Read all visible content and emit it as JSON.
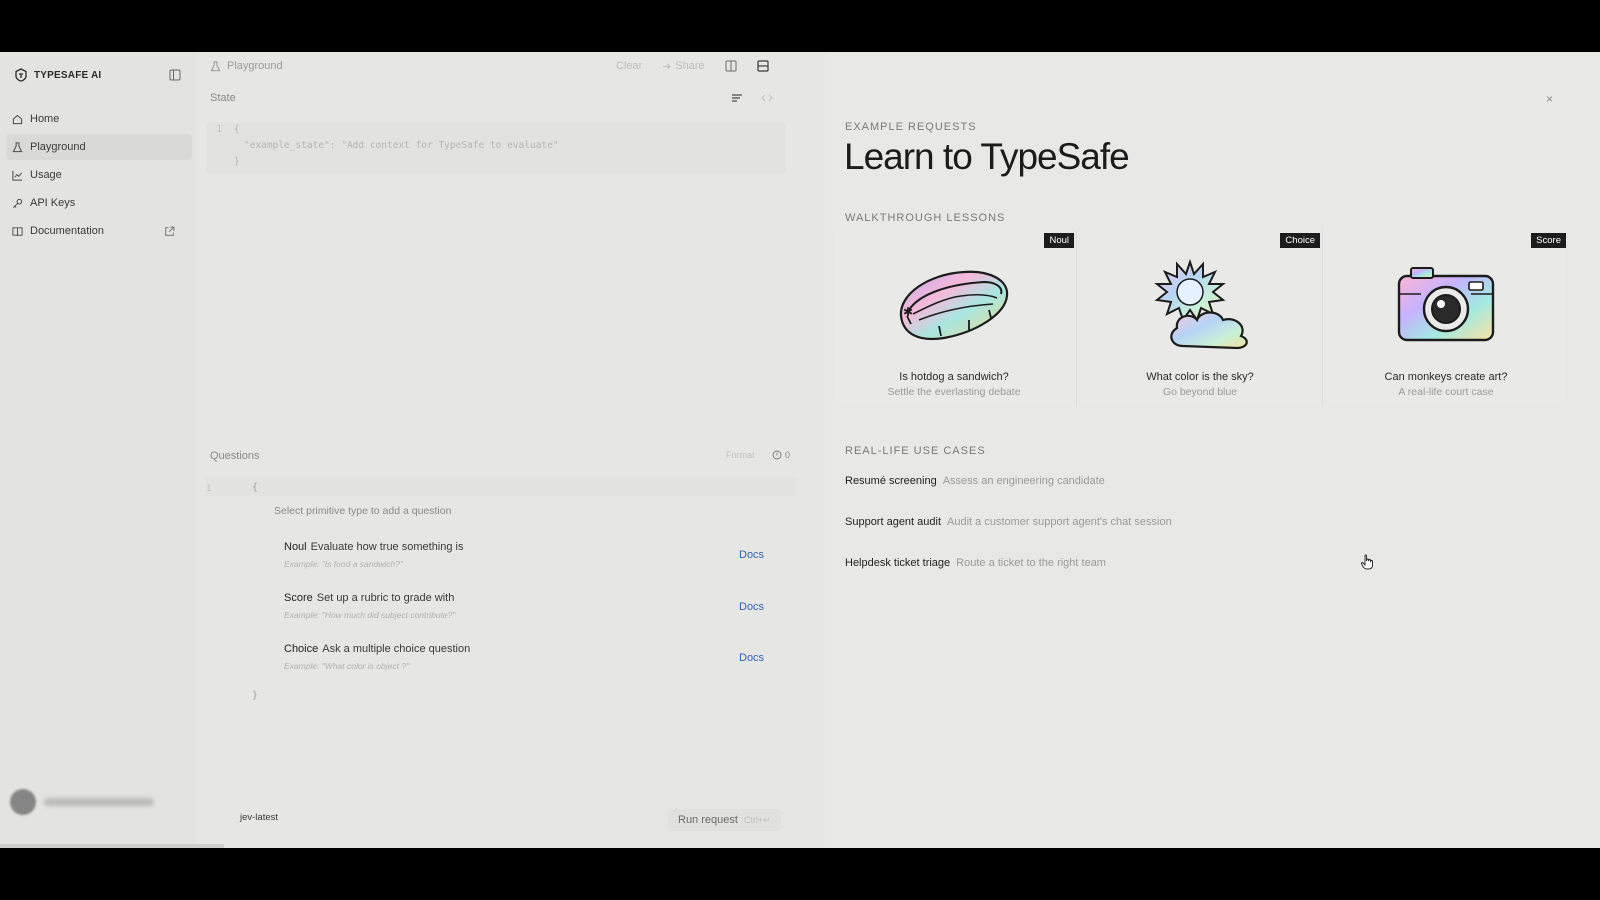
{
  "sidebar": {
    "brand": "TYPESAFE AI",
    "items": [
      {
        "label": "Home",
        "icon": "home-icon"
      },
      {
        "label": "Playground",
        "icon": "flask-icon",
        "active": true
      },
      {
        "label": "Usage",
        "icon": "chart-icon"
      },
      {
        "label": "API Keys",
        "icon": "key-icon"
      },
      {
        "label": "Documentation",
        "icon": "book-icon",
        "external": true
      }
    ]
  },
  "editor": {
    "breadcrumb": "Playground",
    "actions": {
      "clear": "Clear",
      "share": "Share"
    },
    "state": {
      "label": "State",
      "lines": [
        {
          "n": "1",
          "text": "{"
        },
        {
          "n": "",
          "text": "\"example_state\": \"Add context for TypeSafe to evaluate\""
        },
        {
          "n": "",
          "text": "}"
        }
      ]
    },
    "questions": {
      "label": "Questions",
      "format": "Format",
      "count": "0",
      "line_no": "1",
      "open": "{",
      "close": "}",
      "hint": "Select primitive type to add a question",
      "primitives": [
        {
          "name": "Noul",
          "desc": "Evaluate how true something is",
          "example": "Example: \"Is  food  a sandwich?\"",
          "docs": "Docs"
        },
        {
          "name": "Score",
          "desc": "Set up a rubric to grade with",
          "example": "Example: \"How much did  subject  contribute?\"",
          "docs": "Docs"
        },
        {
          "name": "Choice",
          "desc": "Ask a multiple choice question",
          "example": "Example: \"What color is  object ?\"",
          "docs": "Docs"
        }
      ]
    },
    "bottom": {
      "model": "jev-latest",
      "run": "Run  request",
      "kbd": "Ctrl+↵"
    }
  },
  "panel": {
    "close": "×",
    "eyebrow": "EXAMPLE REQUESTS",
    "title": "Learn to TypeSafe",
    "walkthrough_heading": "WALKTHROUGH LESSONS",
    "lessons": [
      {
        "badge": "Noul",
        "title": "Is hotdog a sandwich?",
        "subtitle": "Settle the everlasting debate",
        "art": "hotdog-illustration"
      },
      {
        "badge": "Choice",
        "title": "What color is the sky?",
        "subtitle": "Go beyond blue",
        "art": "sun-cloud-illustration"
      },
      {
        "badge": "Score",
        "title": "Can monkeys create art?",
        "subtitle": "A real-life court case",
        "art": "camera-illustration"
      }
    ],
    "usecases_heading": "REAL-LIFE USE CASES",
    "usecases": [
      {
        "title": "Resumé screening",
        "desc": "Assess an engineering candidate"
      },
      {
        "title": "Support agent audit",
        "desc": "Audit a customer support agent's chat session"
      },
      {
        "title": "Helpdesk ticket triage",
        "desc": "Route a ticket to the right team"
      }
    ]
  },
  "colors": {
    "accent_link": "#3563b0",
    "badge_bg": "#1c1c1c",
    "bg": "#e6e6e5"
  }
}
